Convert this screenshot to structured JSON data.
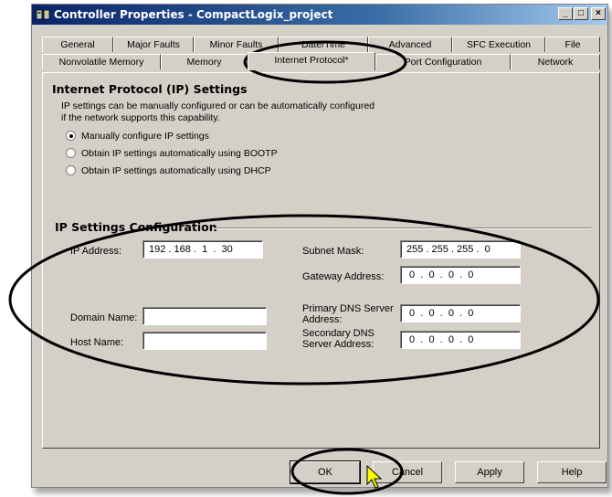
{
  "window": {
    "title": "Controller Properties - CompactLogix_project"
  },
  "tabs_row1": [
    "General",
    "Major Faults",
    "Minor Faults",
    "Date/Time",
    "Advanced",
    "SFC Execution",
    "File"
  ],
  "tabs_row2": [
    "Nonvolatile Memory",
    "Memory",
    "Internet Protocol*",
    "Port Configuration",
    "Network"
  ],
  "active_tab": "Internet Protocol*",
  "ip_protocol": {
    "heading": "Internet Protocol (IP) Settings",
    "desc_line1": "IP settings can be manually configured or can be automatically configured",
    "desc_line2": "if the network supports this capability.",
    "options": [
      {
        "label": "Manually configure IP settings",
        "selected": true
      },
      {
        "label": "Obtain IP settings automatically using BOOTP",
        "selected": false
      },
      {
        "label": "Obtain IP settings automatically using DHCP",
        "selected": false
      }
    ]
  },
  "ip_config": {
    "heading": "IP Settings Configuration",
    "ip_address_label": "IP Address:",
    "ip_address": "192 . 168 .  1  .  30",
    "subnet_mask_label": "Subnet Mask:",
    "subnet_mask": "255 . 255 . 255 .  0",
    "gateway_label": "Gateway Address:",
    "gateway": " 0  .  0  .  0  .  0",
    "domain_label": "Domain Name:",
    "domain": "",
    "host_label": "Host Name:",
    "host": "",
    "primary_dns_label_1": "Primary DNS Server",
    "primary_dns_label_2": "Address:",
    "primary_dns": " 0  .  0  .  0  .  0",
    "secondary_dns_label_1": "Secondary DNS",
    "secondary_dns_label_2": "Server Address:",
    "secondary_dns": " 0  .  0  .  0  .  0"
  },
  "buttons": {
    "ok": "OK",
    "cancel": "Cancel",
    "apply": "Apply",
    "help": "Help"
  },
  "title_buttons": {
    "minimize": "_",
    "maximize": "□",
    "close": "×"
  },
  "colors": {
    "annotation": "#000000",
    "dialog_bg": "#d4d0c8",
    "title_start": "#0a246a"
  }
}
